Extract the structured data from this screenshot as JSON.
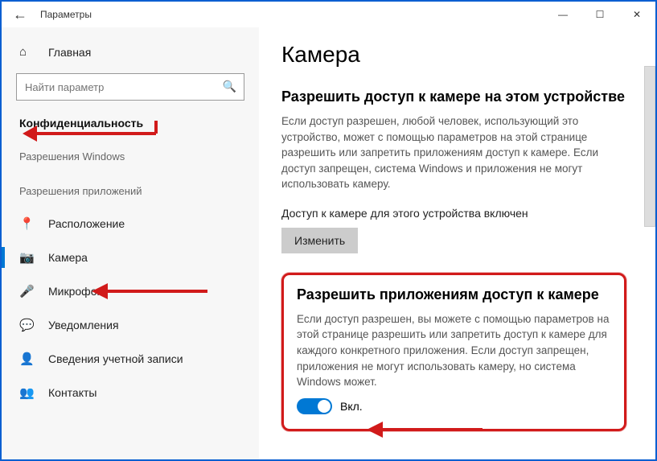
{
  "titlebar": {
    "title": "Параметры"
  },
  "sidebar": {
    "home": "Главная",
    "search_placeholder": "Найти параметр",
    "category": "Конфиденциальность",
    "subhead": "Разрешения Windows",
    "apphead": "Разрешения приложений",
    "items": [
      {
        "icon": "📍",
        "label": "Расположение"
      },
      {
        "icon": "📷",
        "label": "Камера"
      },
      {
        "icon": "🎤",
        "label": "Микрофон"
      },
      {
        "icon": "💬",
        "label": "Уведомления"
      },
      {
        "icon": "👤",
        "label": "Сведения учетной записи"
      },
      {
        "icon": "👥",
        "label": "Контакты"
      }
    ]
  },
  "content": {
    "page_title": "Камера",
    "sec1_title": "Разрешить доступ к камере на этом устройстве",
    "sec1_text": "Если доступ разрешен, любой человек, использующий это устройство, может с помощью параметров на этой странице разрешить или запретить приложениям доступ к камере. Если доступ запрещен, система Windows и приложения не могут использовать камеру.",
    "sec1_status": "Доступ к камере для этого устройства включен",
    "sec1_btn": "Изменить",
    "sec2_title": "Разрешить приложениям доступ к камере",
    "sec2_text": "Если доступ разрешен, вы можете с помощью параметров на этой странице разрешить или запретить доступ к камере для каждого конкретного приложения. Если доступ запрещен, приложения не могут использовать камеру, но система Windows может.",
    "toggle_label": "Вкл."
  }
}
